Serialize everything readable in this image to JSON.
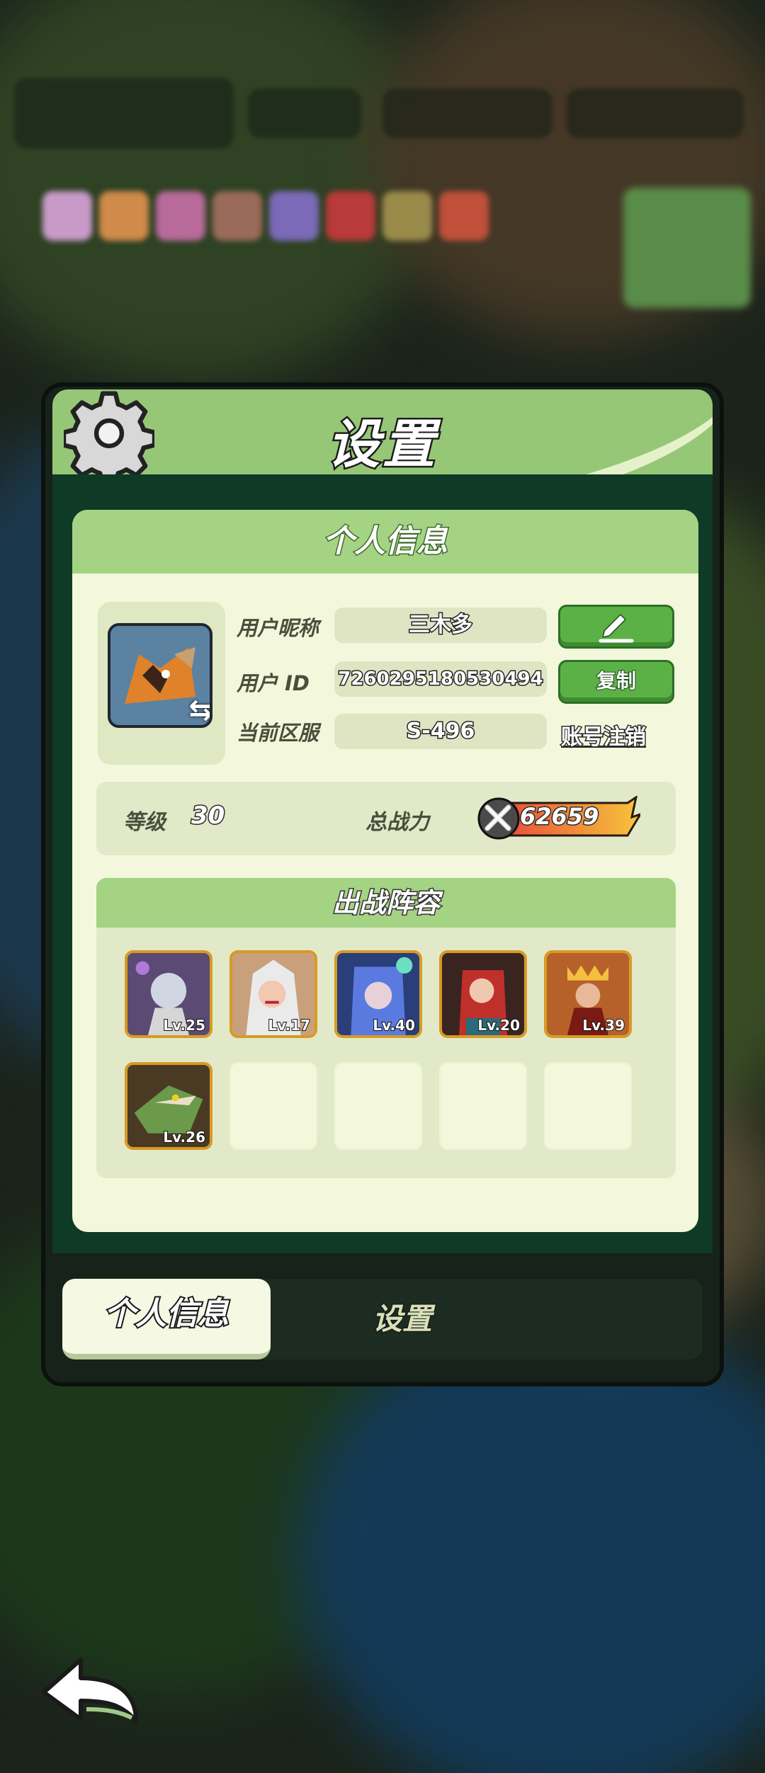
{
  "dialog": {
    "title": "设置"
  },
  "profile_card": {
    "header": "个人信息",
    "nickname_label": "用户昵称",
    "nickname_value": "三木多",
    "user_id_label": "用户 ID",
    "user_id_value": "7260295180530494",
    "server_label": "当前区服",
    "server_value": "S-496",
    "copy_button": "复制",
    "deregister_link": "账号注销",
    "level_label": "等级",
    "level_value": "30",
    "power_label": "总战力",
    "power_value": "62659"
  },
  "lineup": {
    "header": "出战阵容",
    "heroes": [
      {
        "level": "Lv.25",
        "color": "#5a4a74"
      },
      {
        "level": "Lv.17",
        "color": "#c8a07c"
      },
      {
        "level": "Lv.40",
        "color": "#3f5fb8"
      },
      {
        "level": "Lv.20",
        "color": "#9a2d2d"
      },
      {
        "level": "Lv.39",
        "color": "#b7612a"
      },
      {
        "level": "Lv.26",
        "color": "#5f7a3a"
      }
    ]
  },
  "tabs": {
    "active": "个人信息",
    "inactive": "设置"
  },
  "colors": {
    "accent_green": "#5cb146",
    "header_green": "#a4d383",
    "card_bg": "#f3f8dc",
    "frame_border": "#d89a24"
  }
}
